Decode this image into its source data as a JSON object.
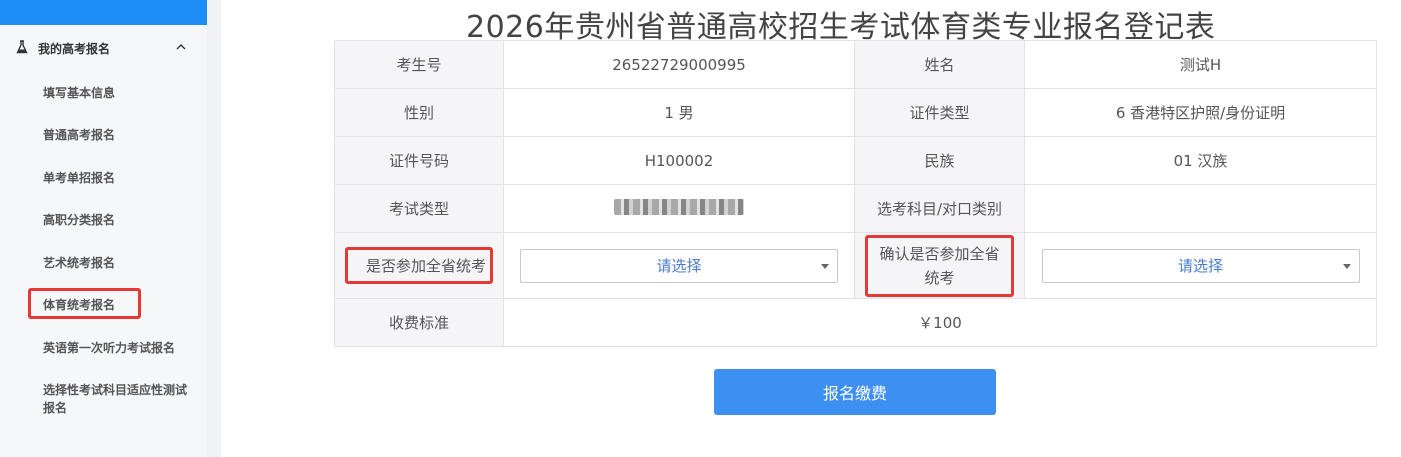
{
  "page": {
    "title": "2026年贵州省普通高校招生考试体育类专业报名登记表"
  },
  "sidebar": {
    "group": {
      "label": "我的高考报名",
      "icon": "flask-icon",
      "expanded": true
    },
    "items": [
      {
        "label": "填写基本信息"
      },
      {
        "label": "普通高考报名"
      },
      {
        "label": "单考单招报名"
      },
      {
        "label": "高职分类报名"
      },
      {
        "label": "艺术统考报名"
      },
      {
        "label": "体育统考报名",
        "active": true
      },
      {
        "label": "英语第一次听力考试报名"
      },
      {
        "label": "选择性考试科目适应性测试报名"
      }
    ],
    "accent": "#1e8df5"
  },
  "form": {
    "rows": [
      {
        "l1": "考生号",
        "v1": "26522729000995",
        "l2": "姓名",
        "v2": "测试H"
      },
      {
        "l1": "性别",
        "v1": "1 男",
        "l2": "证件类型",
        "v2": "6 香港特区护照/身份证明"
      },
      {
        "l1": "证件号码",
        "v1": "H100002",
        "l2": "民族",
        "v2": "01 汉族"
      },
      {
        "l1": "考试类型",
        "v1": "",
        "l2": "选考科目/对口类别",
        "v2": ""
      }
    ],
    "join_label": "是否参加全省统考",
    "join_select": "请选择",
    "confirm_label": "确认是否参加全省统考",
    "confirm_select": "请选择",
    "fee_label": "收费标准",
    "fee_value": "￥100"
  },
  "actions": {
    "pay_label": "报名缴费",
    "color": "#3d8ff2"
  },
  "highlight_color": "#e53935"
}
